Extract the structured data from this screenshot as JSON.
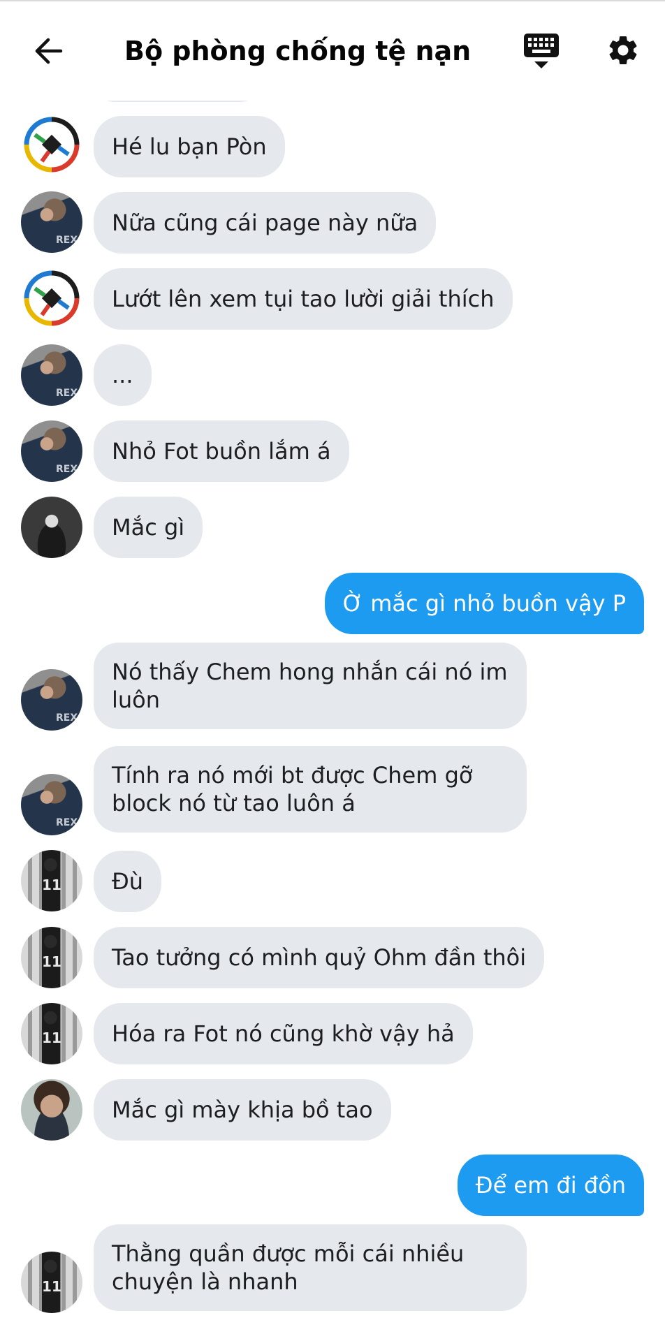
{
  "header": {
    "title": "Bộ phòng chống tệ nạn họ...",
    "back_icon": "arrow-left-icon",
    "keyboard_icon": "keyboard-icon",
    "settings_icon": "gear-icon"
  },
  "colors": {
    "incoming_bubble": "#e5e8ec",
    "outgoing_bubble": "#1d9bf0",
    "outgoing_text": "#ffffff"
  },
  "messages": [
    {
      "direction": "incoming",
      "avatar": "group-logo",
      "text": "Hé lu bạn Pòn"
    },
    {
      "direction": "incoming",
      "avatar": "blue-shirt-user",
      "text": "Nữa cũng cái page này nữa"
    },
    {
      "direction": "incoming",
      "avatar": "group-logo",
      "text": "Lướt lên xem tụi tao lười giải thích"
    },
    {
      "direction": "incoming",
      "avatar": "blue-shirt-user",
      "text": "..."
    },
    {
      "direction": "incoming",
      "avatar": "blue-shirt-user",
      "text": "Nhỏ Fot buồn lắm á"
    },
    {
      "direction": "incoming",
      "avatar": "dark-photo-user",
      "text": "Mắc gì"
    },
    {
      "direction": "outgoing",
      "text": "Ờ mắc gì nhỏ buồn vậy P"
    },
    {
      "direction": "incoming",
      "avatar": "blue-shirt-user",
      "text": "Nó thấy Chem hong nhắn cái nó im luôn"
    },
    {
      "direction": "incoming",
      "avatar": "blue-shirt-user",
      "text": "Tính ra nó mới bt được Chem gỡ block nó từ tao luôn á"
    },
    {
      "direction": "incoming",
      "avatar": "jersey-user",
      "text": "Đù"
    },
    {
      "direction": "incoming",
      "avatar": "jersey-user",
      "text": "Tao tưởng có mình quỷ Ohm đần thôi"
    },
    {
      "direction": "incoming",
      "avatar": "jersey-user",
      "text": "Hóa ra Fot nó cũng khờ vậy hả"
    },
    {
      "direction": "incoming",
      "avatar": "portrait-user",
      "text": "Mắc gì mày khịa bồ tao"
    },
    {
      "direction": "outgoing",
      "text": "Để em đi đồn"
    },
    {
      "direction": "incoming",
      "avatar": "jersey-user",
      "text": "Thằng quần được mỗi cái nhiều chuyện là nhanh"
    }
  ]
}
